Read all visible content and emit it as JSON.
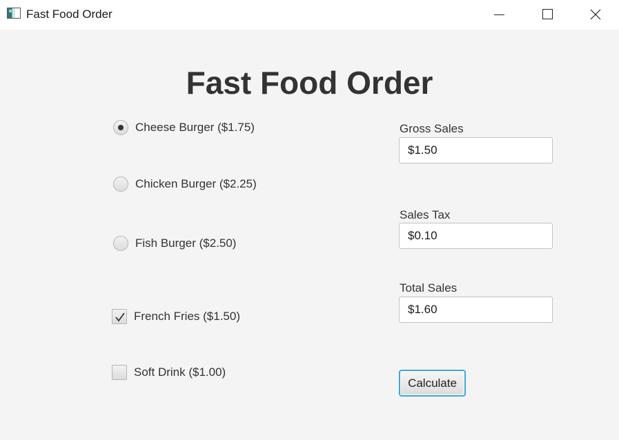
{
  "window": {
    "title": "Fast Food Order"
  },
  "heading": "Fast Food Order",
  "burgers": [
    {
      "label": "Cheese Burger ($1.75)",
      "selected": true
    },
    {
      "label": "Chicken Burger ($2.25)",
      "selected": false
    },
    {
      "label": "Fish Burger ($2.50)",
      "selected": false
    }
  ],
  "extras": [
    {
      "label": "French Fries ($1.50)",
      "checked": true
    },
    {
      "label": "Soft Drink ($1.00)",
      "checked": false
    }
  ],
  "fields": {
    "gross_sales": {
      "label": "Gross Sales",
      "value": "$1.50"
    },
    "sales_tax": {
      "label": "Sales Tax",
      "value": "$0.10"
    },
    "total_sales": {
      "label": "Total Sales",
      "value": "$1.60"
    }
  },
  "calculate_label": "Calculate",
  "colors": {
    "focus_accent": "#3aa7d9",
    "background": "#f4f4f4",
    "text": "#333333"
  }
}
